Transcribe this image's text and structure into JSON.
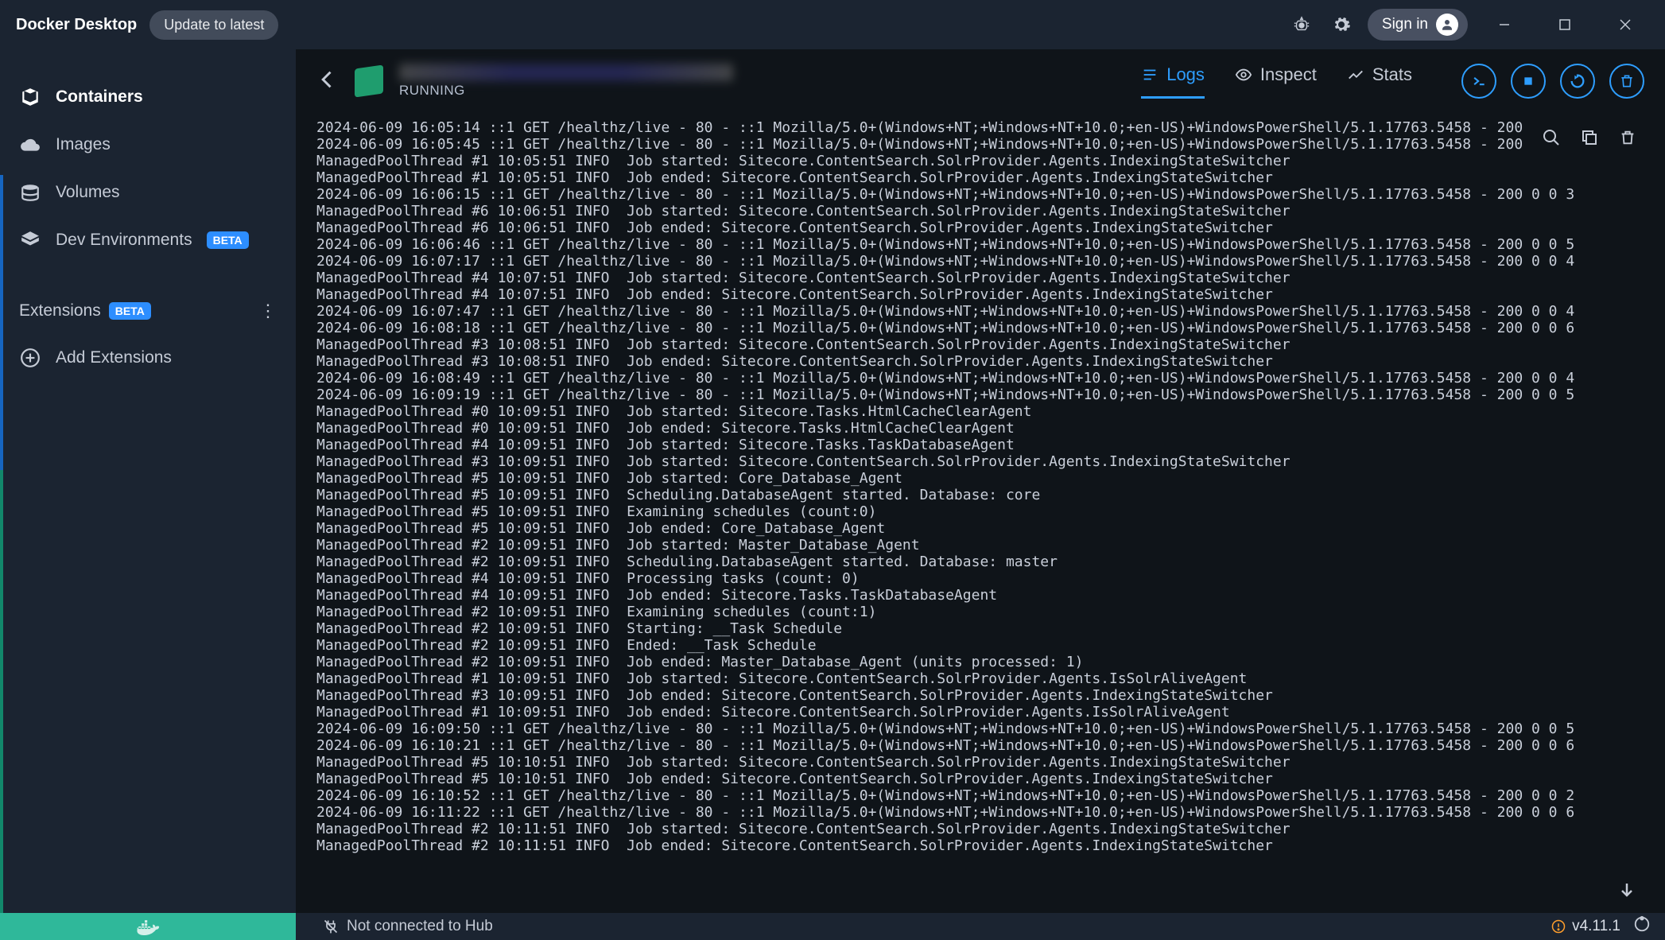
{
  "titlebar": {
    "app_title": "Docker Desktop",
    "update_label": "Update to latest",
    "signin_label": "Sign in"
  },
  "window_controls": {
    "minimize": "–",
    "maximize": "▢",
    "close": "✕"
  },
  "sidebar": {
    "items": [
      {
        "label": "Containers",
        "icon": "layers"
      },
      {
        "label": "Images",
        "icon": "cloud"
      },
      {
        "label": "Volumes",
        "icon": "disk"
      },
      {
        "label": "Dev Environments",
        "icon": "layers",
        "beta": "BETA"
      }
    ],
    "extensions_label": "Extensions",
    "extensions_beta": "BETA",
    "add_extensions_label": "Add Extensions"
  },
  "container": {
    "status": "RUNNING",
    "tabs": {
      "logs": "Logs",
      "inspect": "Inspect",
      "stats": "Stats"
    },
    "actions": [
      "exec",
      "stop",
      "restart",
      "delete"
    ]
  },
  "log_tools": [
    "search",
    "copy",
    "delete"
  ],
  "footer": {
    "hub_status": "Not connected to Hub",
    "version": "v4.11.1"
  },
  "logs": [
    "2024-06-09 16:05:14 ::1 GET /healthz/live - 80 - ::1 Mozilla/5.0+(Windows+NT;+Windows+NT+10.0;+en-US)+WindowsPowerShell/5.1.17763.5458 - 200 0 0 7",
    "2024-06-09 16:05:45 ::1 GET /healthz/live - 80 - ::1 Mozilla/5.0+(Windows+NT;+Windows+NT+10.0;+en-US)+WindowsPowerShell/5.1.17763.5458 - 200 0 0 5",
    "ManagedPoolThread #1 10:05:51 INFO  Job started: Sitecore.ContentSearch.SolrProvider.Agents.IndexingStateSwitcher",
    "ManagedPoolThread #1 10:05:51 INFO  Job ended: Sitecore.ContentSearch.SolrProvider.Agents.IndexingStateSwitcher",
    "2024-06-09 16:06:15 ::1 GET /healthz/live - 80 - ::1 Mozilla/5.0+(Windows+NT;+Windows+NT+10.0;+en-US)+WindowsPowerShell/5.1.17763.5458 - 200 0 0 3",
    "ManagedPoolThread #6 10:06:51 INFO  Job started: Sitecore.ContentSearch.SolrProvider.Agents.IndexingStateSwitcher",
    "ManagedPoolThread #6 10:06:51 INFO  Job ended: Sitecore.ContentSearch.SolrProvider.Agents.IndexingStateSwitcher",
    "2024-06-09 16:06:46 ::1 GET /healthz/live - 80 - ::1 Mozilla/5.0+(Windows+NT;+Windows+NT+10.0;+en-US)+WindowsPowerShell/5.1.17763.5458 - 200 0 0 5",
    "2024-06-09 16:07:17 ::1 GET /healthz/live - 80 - ::1 Mozilla/5.0+(Windows+NT;+Windows+NT+10.0;+en-US)+WindowsPowerShell/5.1.17763.5458 - 200 0 0 4",
    "ManagedPoolThread #4 10:07:51 INFO  Job started: Sitecore.ContentSearch.SolrProvider.Agents.IndexingStateSwitcher",
    "ManagedPoolThread #4 10:07:51 INFO  Job ended: Sitecore.ContentSearch.SolrProvider.Agents.IndexingStateSwitcher",
    "2024-06-09 16:07:47 ::1 GET /healthz/live - 80 - ::1 Mozilla/5.0+(Windows+NT;+Windows+NT+10.0;+en-US)+WindowsPowerShell/5.1.17763.5458 - 200 0 0 4",
    "2024-06-09 16:08:18 ::1 GET /healthz/live - 80 - ::1 Mozilla/5.0+(Windows+NT;+Windows+NT+10.0;+en-US)+WindowsPowerShell/5.1.17763.5458 - 200 0 0 6",
    "ManagedPoolThread #3 10:08:51 INFO  Job started: Sitecore.ContentSearch.SolrProvider.Agents.IndexingStateSwitcher",
    "ManagedPoolThread #3 10:08:51 INFO  Job ended: Sitecore.ContentSearch.SolrProvider.Agents.IndexingStateSwitcher",
    "2024-06-09 16:08:49 ::1 GET /healthz/live - 80 - ::1 Mozilla/5.0+(Windows+NT;+Windows+NT+10.0;+en-US)+WindowsPowerShell/5.1.17763.5458 - 200 0 0 4",
    "2024-06-09 16:09:19 ::1 GET /healthz/live - 80 - ::1 Mozilla/5.0+(Windows+NT;+Windows+NT+10.0;+en-US)+WindowsPowerShell/5.1.17763.5458 - 200 0 0 5",
    "ManagedPoolThread #0 10:09:51 INFO  Job started: Sitecore.Tasks.HtmlCacheClearAgent",
    "ManagedPoolThread #0 10:09:51 INFO  Job ended: Sitecore.Tasks.HtmlCacheClearAgent",
    "ManagedPoolThread #4 10:09:51 INFO  Job started: Sitecore.Tasks.TaskDatabaseAgent",
    "ManagedPoolThread #3 10:09:51 INFO  Job started: Sitecore.ContentSearch.SolrProvider.Agents.IndexingStateSwitcher",
    "ManagedPoolThread #5 10:09:51 INFO  Job started: Core_Database_Agent",
    "ManagedPoolThread #5 10:09:51 INFO  Scheduling.DatabaseAgent started. Database: core",
    "ManagedPoolThread #5 10:09:51 INFO  Examining schedules (count:0)",
    "ManagedPoolThread #5 10:09:51 INFO  Job ended: Core_Database_Agent",
    "ManagedPoolThread #2 10:09:51 INFO  Job started: Master_Database_Agent",
    "ManagedPoolThread #2 10:09:51 INFO  Scheduling.DatabaseAgent started. Database: master",
    "ManagedPoolThread #4 10:09:51 INFO  Processing tasks (count: 0)",
    "ManagedPoolThread #4 10:09:51 INFO  Job ended: Sitecore.Tasks.TaskDatabaseAgent",
    "ManagedPoolThread #2 10:09:51 INFO  Examining schedules (count:1)",
    "ManagedPoolThread #2 10:09:51 INFO  Starting: __Task Schedule",
    "ManagedPoolThread #2 10:09:51 INFO  Ended: __Task Schedule",
    "ManagedPoolThread #2 10:09:51 INFO  Job ended: Master_Database_Agent (units processed: 1)",
    "ManagedPoolThread #1 10:09:51 INFO  Job started: Sitecore.ContentSearch.SolrProvider.Agents.IsSolrAliveAgent",
    "ManagedPoolThread #3 10:09:51 INFO  Job ended: Sitecore.ContentSearch.SolrProvider.Agents.IndexingStateSwitcher",
    "ManagedPoolThread #1 10:09:51 INFO  Job ended: Sitecore.ContentSearch.SolrProvider.Agents.IsSolrAliveAgent",
    "2024-06-09 16:09:50 ::1 GET /healthz/live - 80 - ::1 Mozilla/5.0+(Windows+NT;+Windows+NT+10.0;+en-US)+WindowsPowerShell/5.1.17763.5458 - 200 0 0 5",
    "2024-06-09 16:10:21 ::1 GET /healthz/live - 80 - ::1 Mozilla/5.0+(Windows+NT;+Windows+NT+10.0;+en-US)+WindowsPowerShell/5.1.17763.5458 - 200 0 0 6",
    "ManagedPoolThread #5 10:10:51 INFO  Job started: Sitecore.ContentSearch.SolrProvider.Agents.IndexingStateSwitcher",
    "ManagedPoolThread #5 10:10:51 INFO  Job ended: Sitecore.ContentSearch.SolrProvider.Agents.IndexingStateSwitcher",
    "2024-06-09 16:10:52 ::1 GET /healthz/live - 80 - ::1 Mozilla/5.0+(Windows+NT;+Windows+NT+10.0;+en-US)+WindowsPowerShell/5.1.17763.5458 - 200 0 0 2",
    "2024-06-09 16:11:22 ::1 GET /healthz/live - 80 - ::1 Mozilla/5.0+(Windows+NT;+Windows+NT+10.0;+en-US)+WindowsPowerShell/5.1.17763.5458 - 200 0 0 6",
    "ManagedPoolThread #2 10:11:51 INFO  Job started: Sitecore.ContentSearch.SolrProvider.Agents.IndexingStateSwitcher",
    "ManagedPoolThread #2 10:11:51 INFO  Job ended: Sitecore.ContentSearch.SolrProvider.Agents.IndexingStateSwitcher"
  ]
}
